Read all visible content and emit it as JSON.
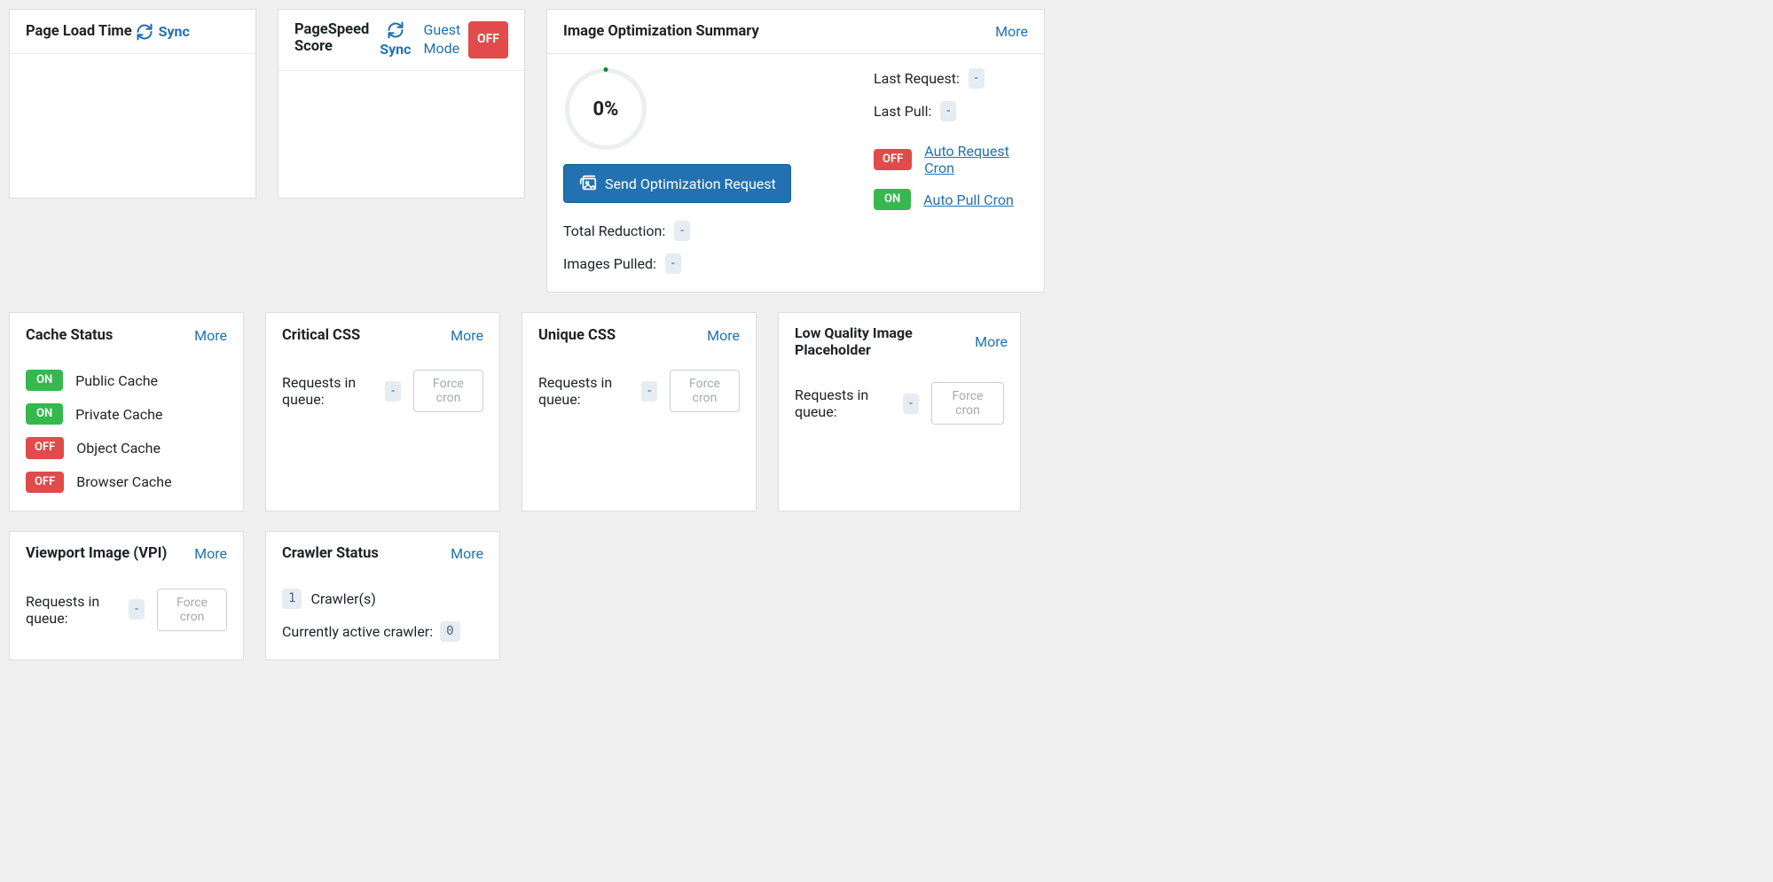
{
  "common": {
    "more": "More",
    "sync": "Sync",
    "on": "ON",
    "off": "OFF",
    "dash": "-",
    "force_cron": "Force cron",
    "req_in_queue": "Requests in queue:"
  },
  "page_load_time": {
    "title": "Page Load Time"
  },
  "pagespeed": {
    "title_l1": "PageSpeed",
    "title_l2": "Score",
    "guest_l1": "Guest",
    "guest_l2": "Mode",
    "guest_state": "OFF"
  },
  "image_opt": {
    "title": "Image Optimization Summary",
    "percent": "0%",
    "send_request": "Send Optimization Request",
    "total_reduction": "Total Reduction:",
    "images_pulled": "Images Pulled:",
    "last_request": "Last Request:",
    "last_pull": "Last Pull:",
    "auto_request_cron": "Auto Request Cron",
    "auto_request_state": "OFF",
    "auto_pull_cron": "Auto Pull Cron",
    "auto_pull_state": "ON"
  },
  "cache_status": {
    "title": "Cache Status",
    "items": [
      {
        "label": "Public Cache",
        "state": "ON"
      },
      {
        "label": "Private Cache",
        "state": "ON"
      },
      {
        "label": "Object Cache",
        "state": "OFF"
      },
      {
        "label": "Browser Cache",
        "state": "OFF"
      }
    ]
  },
  "critical_css": {
    "title": "Critical CSS",
    "queue": "-"
  },
  "unique_css": {
    "title": "Unique CSS",
    "queue": "-"
  },
  "lqip": {
    "title": "Low Quality Image Placeholder",
    "queue": "-"
  },
  "vpi": {
    "title": "Viewport Image (VPI)",
    "queue": "-"
  },
  "crawler": {
    "title": "Crawler Status",
    "count": "1",
    "count_label": "Crawler(s)",
    "active_label": "Currently active crawler:",
    "active_id": "0"
  }
}
